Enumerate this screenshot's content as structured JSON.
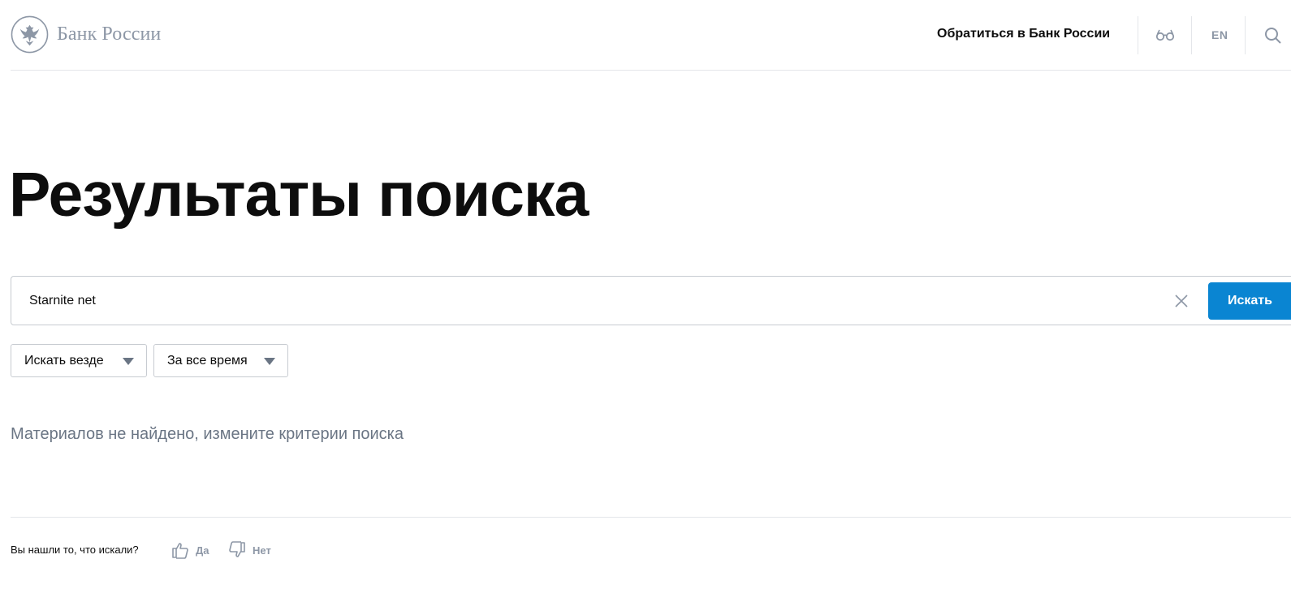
{
  "header": {
    "logo_text": "Банк России",
    "contact_link": "Обратиться в Банк России",
    "lang_label": "EN",
    "icons": {
      "logo": "double-headed-eagle-emblem",
      "accessibility": "glasses-icon",
      "search": "search-icon"
    }
  },
  "main": {
    "title": "Результаты поиска",
    "search": {
      "value": "Starnite net",
      "submit_label": "Искать"
    },
    "filters": [
      {
        "label": "Искать везде"
      },
      {
        "label": "За все время"
      }
    ],
    "empty_message": "Материалов не найдено, измените критерии поиска"
  },
  "feedback": {
    "question": "Вы нашли то, что искали?",
    "yes_label": "Да",
    "no_label": "Нет"
  },
  "colors": {
    "accent": "#0a85d2",
    "muted": "#8d97a6",
    "text": "#0d0d0d",
    "border": "#c7cbd1"
  }
}
